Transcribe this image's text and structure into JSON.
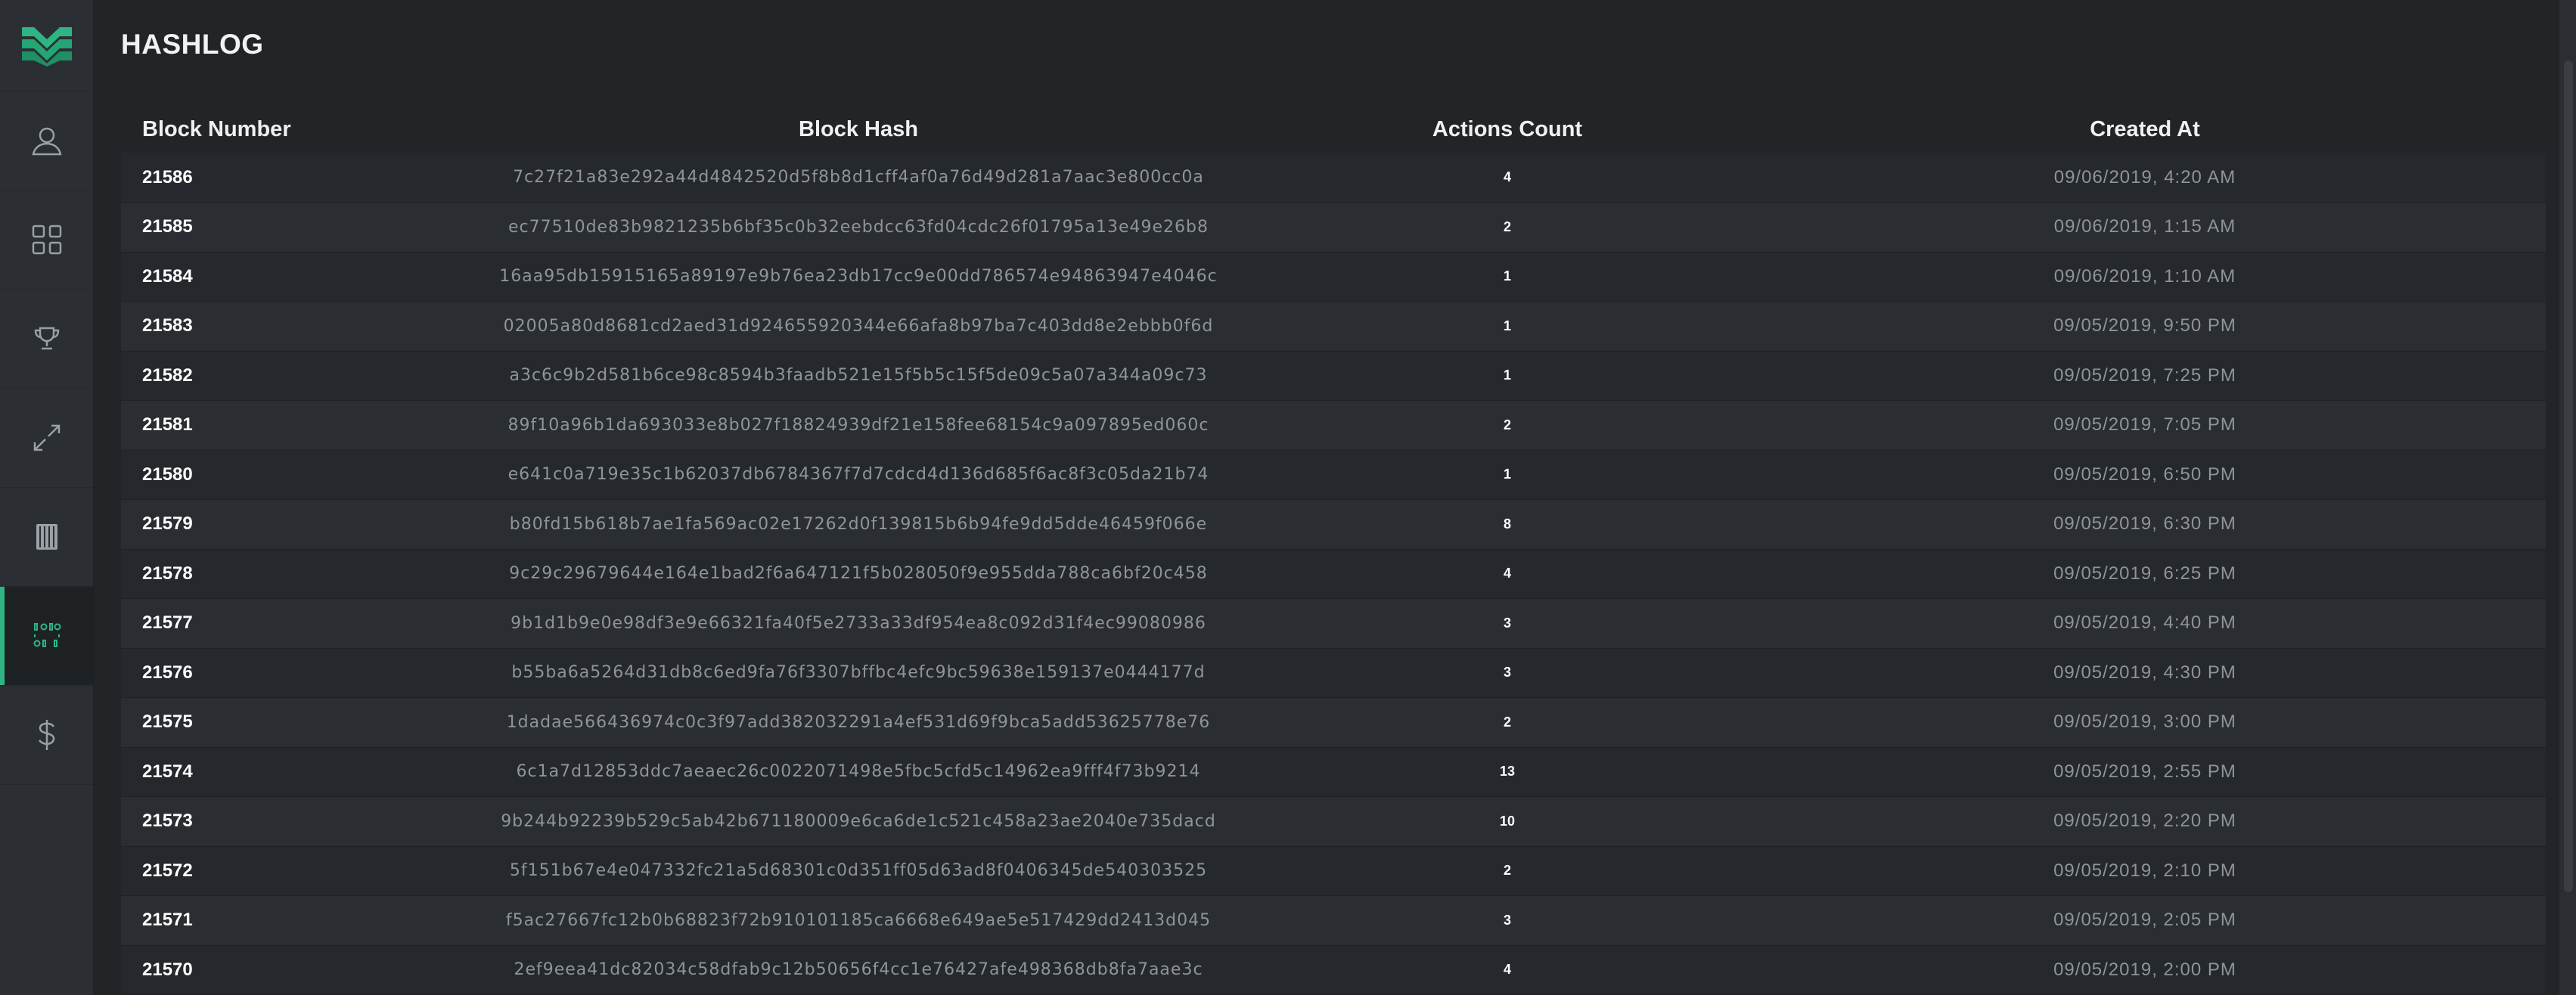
{
  "app": {
    "title": "HASHLOG",
    "accent_color": "#2fb584"
  },
  "sidebar": {
    "logo_icon": "brand-logo-icon",
    "items": [
      {
        "icon": "user-icon",
        "active": false
      },
      {
        "icon": "dashboard-grid-icon",
        "active": false
      },
      {
        "icon": "trophy-icon",
        "active": false
      },
      {
        "icon": "transfer-arrows-icon",
        "active": false
      },
      {
        "icon": "ledger-book-icon",
        "active": false
      },
      {
        "icon": "binary-hash-icon",
        "active": true
      },
      {
        "icon": "dollar-icon",
        "active": false
      }
    ]
  },
  "table": {
    "headers": {
      "block_number": "Block Number",
      "block_hash": "Block Hash",
      "actions_count": "Actions Count",
      "created_at": "Created At"
    },
    "rows": [
      {
        "block_number": "21586",
        "block_hash": "7c27f21a83e292a44d4842520d5f8b8d1cff4af0a76d49d281a7aac3e800cc0a",
        "actions_count": "4",
        "created_at": "09/06/2019, 4:20 AM"
      },
      {
        "block_number": "21585",
        "block_hash": "ec77510de83b9821235b6bf35c0b32eebdcc63fd04cdc26f01795a13e49e26b8",
        "actions_count": "2",
        "created_at": "09/06/2019, 1:15 AM"
      },
      {
        "block_number": "21584",
        "block_hash": "16aa95db15915165a89197e9b76ea23db17cc9e00dd786574e94863947e4046c",
        "actions_count": "1",
        "created_at": "09/06/2019, 1:10 AM"
      },
      {
        "block_number": "21583",
        "block_hash": "02005a80d8681cd2aed31d924655920344e66afa8b97ba7c403dd8e2ebbb0f6d",
        "actions_count": "1",
        "created_at": "09/05/2019, 9:50 PM"
      },
      {
        "block_number": "21582",
        "block_hash": "a3c6c9b2d581b6ce98c8594b3faadb521e15f5b5c15f5de09c5a07a344a09c73",
        "actions_count": "1",
        "created_at": "09/05/2019, 7:25 PM"
      },
      {
        "block_number": "21581",
        "block_hash": "89f10a96b1da693033e8b027f18824939df21e158fee68154c9a097895ed060c",
        "actions_count": "2",
        "created_at": "09/05/2019, 7:05 PM"
      },
      {
        "block_number": "21580",
        "block_hash": "e641c0a719e35c1b62037db6784367f7d7cdcd4d136d685f6ac8f3c05da21b74",
        "actions_count": "1",
        "created_at": "09/05/2019, 6:50 PM"
      },
      {
        "block_number": "21579",
        "block_hash": "b80fd15b618b7ae1fa569ac02e17262d0f139815b6b94fe9dd5dde46459f066e",
        "actions_count": "8",
        "created_at": "09/05/2019, 6:30 PM"
      },
      {
        "block_number": "21578",
        "block_hash": "9c29c29679644e164e1bad2f6a647121f5b028050f9e955dda788ca6bf20c458",
        "actions_count": "4",
        "created_at": "09/05/2019, 6:25 PM"
      },
      {
        "block_number": "21577",
        "block_hash": "9b1d1b9e0e98df3e9e66321fa40f5e2733a33df954ea8c092d31f4ec99080986",
        "actions_count": "3",
        "created_at": "09/05/2019, 4:40 PM"
      },
      {
        "block_number": "21576",
        "block_hash": "b55ba6a5264d31db8c6ed9fa76f3307bffbc4efc9bc59638e159137e0444177d",
        "actions_count": "3",
        "created_at": "09/05/2019, 4:30 PM"
      },
      {
        "block_number": "21575",
        "block_hash": "1dadae566436974c0c3f97add382032291a4ef531d69f9bca5add53625778e76",
        "actions_count": "2",
        "created_at": "09/05/2019, 3:00 PM"
      },
      {
        "block_number": "21574",
        "block_hash": "6c1a7d12853ddc7aeaec26c0022071498e5fbc5cfd5c14962ea9fff4f73b9214",
        "actions_count": "13",
        "created_at": "09/05/2019, 2:55 PM"
      },
      {
        "block_number": "21573",
        "block_hash": "9b244b92239b529c5ab42b671180009e6ca6de1c521c458a23ae2040e735dacd",
        "actions_count": "10",
        "created_at": "09/05/2019, 2:20 PM"
      },
      {
        "block_number": "21572",
        "block_hash": "5f151b67e4e047332fc21a5d68301c0d351ff05d63ad8f0406345de540303525",
        "actions_count": "2",
        "created_at": "09/05/2019, 2:10 PM"
      },
      {
        "block_number": "21571",
        "block_hash": "f5ac27667fc12b0b68823f72b910101185ca6668e649ae5e517429dd2413d045",
        "actions_count": "3",
        "created_at": "09/05/2019, 2:05 PM"
      },
      {
        "block_number": "21570",
        "block_hash": "2ef9eea41dc82034c58dfab9c12b50656f4cc1e76427afe498368db8fa7aae3c",
        "actions_count": "4",
        "created_at": "09/05/2019, 2:00 PM"
      }
    ]
  }
}
